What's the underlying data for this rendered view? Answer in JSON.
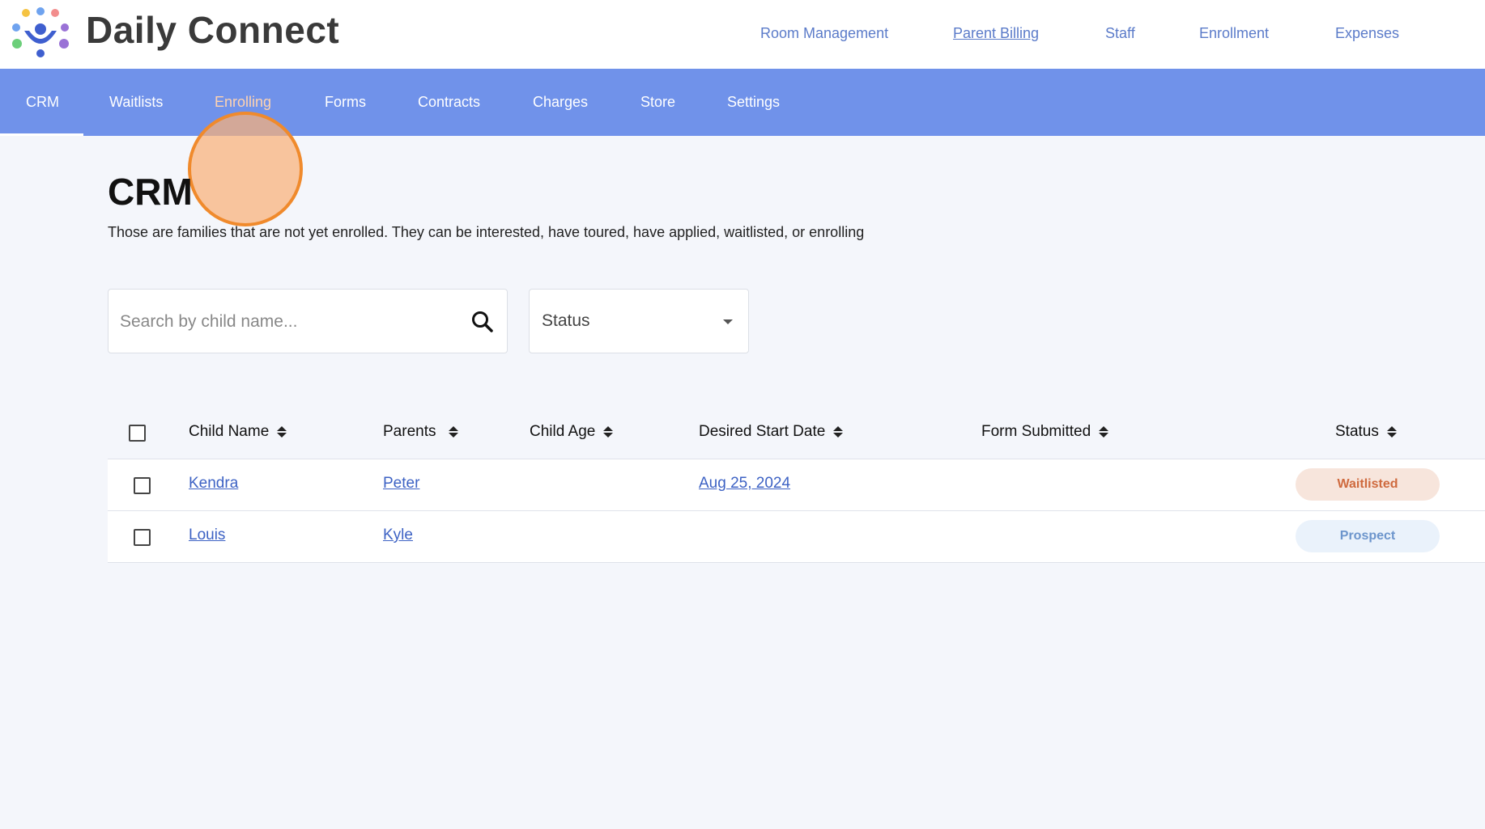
{
  "header": {
    "brand": "Daily Connect",
    "nav": [
      {
        "label": "Room Management"
      },
      {
        "label": "Parent Billing"
      },
      {
        "label": "Staff"
      },
      {
        "label": "Enrollment"
      },
      {
        "label": "Expenses"
      }
    ]
  },
  "tabs": [
    {
      "label": "CRM",
      "active": true
    },
    {
      "label": "Waitlists"
    },
    {
      "label": "Enrolling"
    },
    {
      "label": "Forms"
    },
    {
      "label": "Contracts"
    },
    {
      "label": "Charges"
    },
    {
      "label": "Store"
    },
    {
      "label": "Settings"
    }
  ],
  "page": {
    "title": "CRM",
    "description": "Those are families that are not yet enrolled. They can be interested, have toured, have applied, waitlisted, or enrolling"
  },
  "filters": {
    "search_placeholder": "Search by child name...",
    "status_label": "Status"
  },
  "table": {
    "columns": [
      "Child Name",
      "Parents",
      "Child Age",
      "Desired Start Date",
      "Form Submitted",
      "Status"
    ],
    "rows": [
      {
        "child": "Kendra",
        "parents": "Peter",
        "age": "",
        "start_date": "Aug 25, 2024",
        "form_submitted": "",
        "status": "Waitlisted"
      },
      {
        "child": "Louis",
        "parents": "Kyle",
        "age": "",
        "start_date": "",
        "form_submitted": "",
        "status": "Prospect"
      }
    ]
  },
  "colors": {
    "tab_bar": "#7092ea",
    "accent_orange": "#f08a2c",
    "link": "#3d62c4",
    "waitlisted_text": "#cf6a3e",
    "prospect_text": "#6c95cc"
  }
}
